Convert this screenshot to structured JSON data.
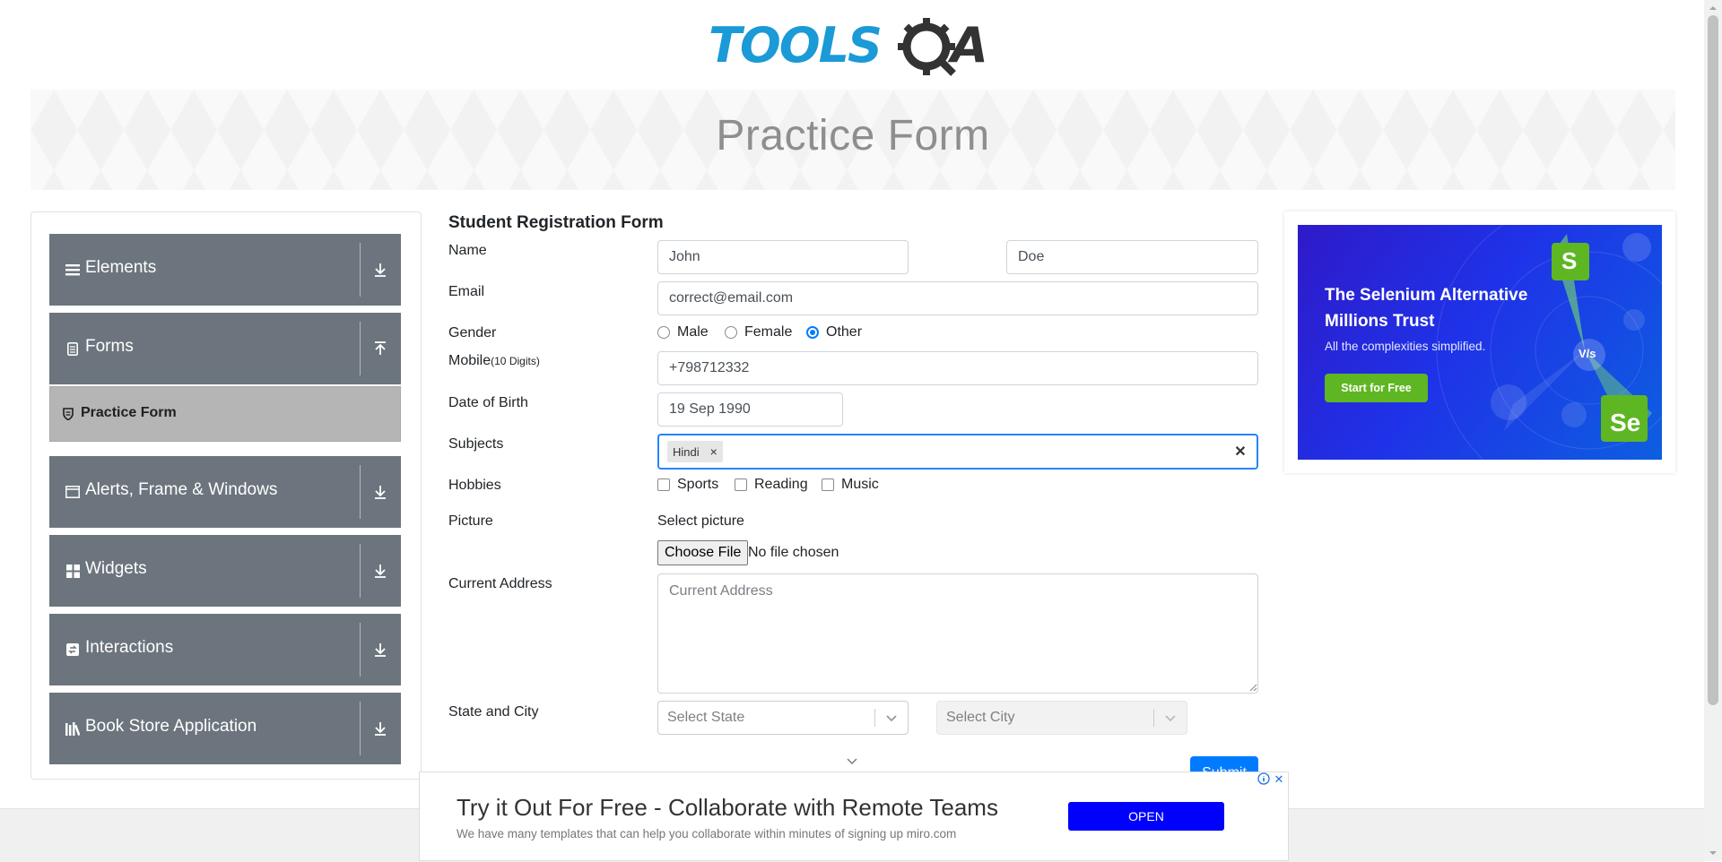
{
  "header": {
    "logo_alt": "TOOLSQA"
  },
  "banner": {
    "title": "Practice Form"
  },
  "sidebar": {
    "groups": [
      {
        "label": "Elements",
        "icon": "list-icon",
        "arrow": "download-arrow-icon"
      },
      {
        "label": "Forms",
        "icon": "form-icon",
        "arrow": "upload-arrow-icon"
      },
      {
        "label": "Alerts, Frame & Windows",
        "icon": "window-icon",
        "arrow": "download-arrow-icon"
      },
      {
        "label": "Widgets",
        "icon": "widgets-icon",
        "arrow": "download-arrow-icon"
      },
      {
        "label": "Interactions",
        "icon": "interactions-icon",
        "arrow": "download-arrow-icon"
      },
      {
        "label": "Book Store Application",
        "icon": "books-icon",
        "arrow": "download-arrow-icon"
      }
    ],
    "active_item": {
      "label": "Practice Form",
      "icon": "shield-icon"
    }
  },
  "form": {
    "title": "Student Registration Form",
    "name_label": "Name",
    "first_name": "John",
    "last_name": "Doe",
    "email_label": "Email",
    "email": "correct@email.com",
    "gender_label": "Gender",
    "gender_options": [
      "Male",
      "Female",
      "Other"
    ],
    "gender_selected": "Other",
    "mobile_label": "Mobile",
    "mobile_hint": "(10 Digits)",
    "mobile": "+798712332",
    "dob_label": "Date of Birth",
    "dob": "19 Sep 1990",
    "subjects_label": "Subjects",
    "subjects": [
      "Hindi"
    ],
    "hobbies_label": "Hobbies",
    "hobbies": [
      "Sports",
      "Reading",
      "Music"
    ],
    "picture_label": "Picture",
    "picture_prompt": "Select picture",
    "choose_file": "Choose File",
    "file_status": "No file chosen",
    "address_label": "Current Address",
    "address_placeholder": "Current Address",
    "state_city_label": "State and City",
    "state_placeholder": "Select State",
    "city_placeholder": "Select City",
    "submit": "Submit"
  },
  "right_ad": {
    "headline": "The Selenium Alternative Millions Trust",
    "sub": "All the complexities simplified.",
    "cta": "Start for Free",
    "badge_s": "S",
    "badge_vs": "V/s",
    "badge_se": "Se"
  },
  "bottom_ad": {
    "title": "Try it Out For Free - Collaborate with Remote Teams",
    "description": "We have many templates that can help you collaborate within minutes of signing up miro.com",
    "open": "OPEN"
  },
  "colors": {
    "primary": "#007bff",
    "sidebar_group": "#6c757d",
    "active_item": "#b5b5b5",
    "logo_blue": "#1a9ad6",
    "logo_dark": "#333333",
    "ad_cta_green": "#5fb623",
    "bottom_open_blue": "#0000ff"
  }
}
